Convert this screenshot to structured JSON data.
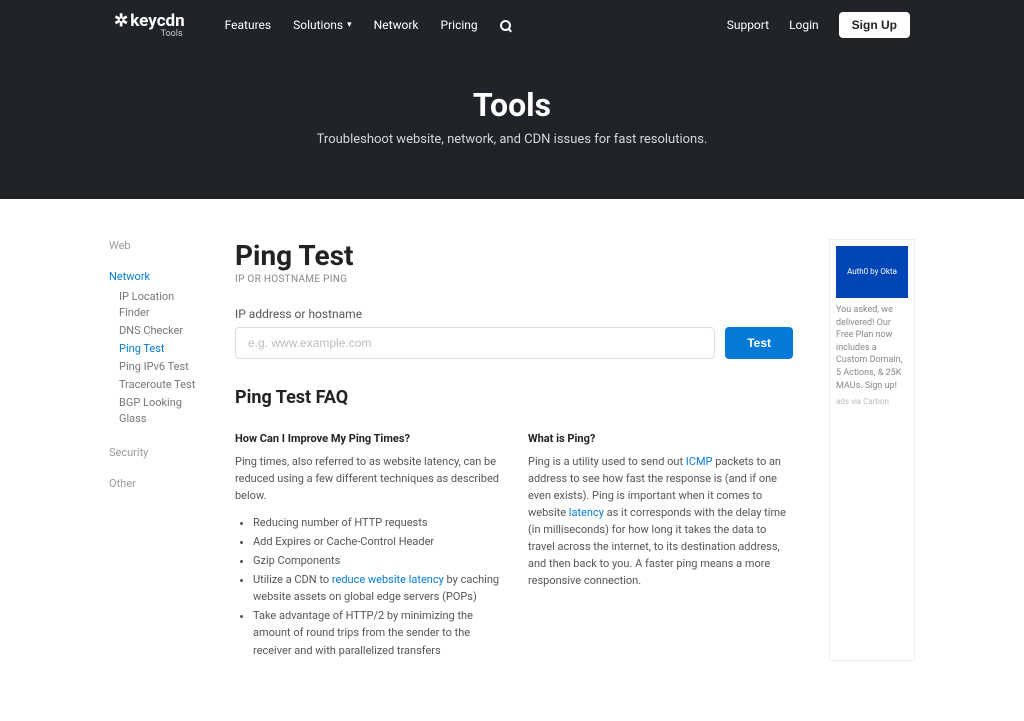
{
  "logo": {
    "name": "keycdn",
    "sub": "Tools"
  },
  "nav": {
    "features": "Features",
    "solutions": "Solutions",
    "network": "Network",
    "pricing": "Pricing",
    "support": "Support",
    "login": "Login",
    "signup": "Sign Up"
  },
  "hero": {
    "title": "Tools",
    "subtitle": "Troubleshoot website, network, and CDN issues for fast resolutions."
  },
  "sidebar": {
    "web": "Web",
    "network": "Network",
    "network_items": {
      "ip": "IP Location Finder",
      "dns": "DNS Checker",
      "ping": "Ping Test",
      "ipv6": "Ping IPv6 Test",
      "trace": "Traceroute Test",
      "bgp": "BGP Looking Glass"
    },
    "security": "Security",
    "other": "Other"
  },
  "page": {
    "title": "Ping Test",
    "subtitle": "IP OR HOSTNAME PING",
    "input_label": "IP address or hostname",
    "placeholder": "e.g. www.example.com",
    "button": "Test"
  },
  "faq": {
    "title": "Ping Test FAQ",
    "q1": "How Can I Improve My Ping Times?",
    "q1_intro": "Ping times, also referred to as website latency, can be reduced using a few different techniques as described below.",
    "li1": "Reducing number of HTTP requests",
    "li2": "Add Expires or Cache-Control Header",
    "li3": "Gzip Components",
    "li4a": "Utilize a CDN to ",
    "li4link": "reduce website latency",
    "li4b": " by caching website assets on global edge servers (POPs)",
    "li5": "Take advantage of HTTP/2 by minimizing the amount of round trips from the sender to the receiver and with parallelized transfers",
    "q2": "What is Ping?",
    "q2a": "Ping is a utility used to send out ",
    "q2link1": "ICMP",
    "q2b": " packets to an address to see how fast the response is (and if one even exists). Ping is important when it comes to website ",
    "q2link2": "latency",
    "q2c": " as it corresponds with the delay time (in milliseconds) for how long it takes the data to travel across the internet, to its destination address, and then back to you. A faster ping means a more responsive connection."
  },
  "ad": {
    "img_text": "Auth0 by Okta",
    "copy": "You asked, we delivered! Our Free Plan now includes a Custom Domain, 5 Actions, & 25K MAUs. Sign up!",
    "attr": "ads via Carbon"
  }
}
